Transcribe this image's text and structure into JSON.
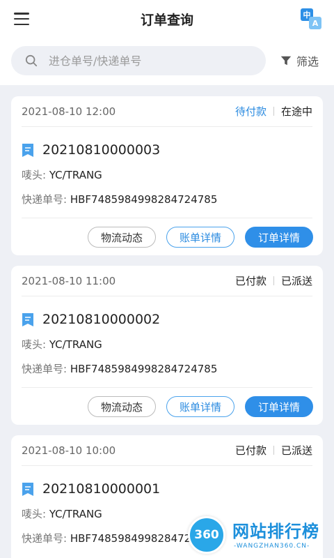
{
  "header": {
    "title": "订单查询",
    "lang_icon_top": "中",
    "lang_icon_bottom": "A"
  },
  "search": {
    "placeholder": "进仓单号/快递单号",
    "filter_label": "筛选"
  },
  "labels": {
    "mark_label": "唛头:",
    "express_label": "快递单号:"
  },
  "buttons": {
    "logistics": "物流动态",
    "bill": "账单详情",
    "order_detail": "订单详情"
  },
  "orders": [
    {
      "time": "2021-08-10 12:00",
      "pay_status": "待付款",
      "ship_status": "在途中",
      "order_no": "20210810000003",
      "mark": "YC/TRANG",
      "express_no": "HBF7485984998284724785"
    },
    {
      "time": "2021-08-10 11:00",
      "pay_status": "已付款",
      "ship_status": "已派送",
      "order_no": "20210810000002",
      "mark": "YC/TRANG",
      "express_no": "HBF7485984998284724785"
    },
    {
      "time": "2021-08-10 10:00",
      "pay_status": "已付款",
      "ship_status": "已派送",
      "order_no": "20210810000001",
      "mark": "YC/TRANG",
      "express_no": "HBF748598499828472"
    }
  ],
  "watermark": {
    "badge": "360",
    "title": "网站排行榜",
    "url": "-WANGZHAN360.CN-"
  },
  "colors": {
    "accent": "#2f8fe8",
    "pending": "#2b8be0",
    "background": "#eef0f5"
  },
  "icons": {
    "menu": "menu-icon",
    "language": "translate-icon",
    "search": "search-icon",
    "filter": "filter-icon",
    "order": "bookmark-icon"
  }
}
